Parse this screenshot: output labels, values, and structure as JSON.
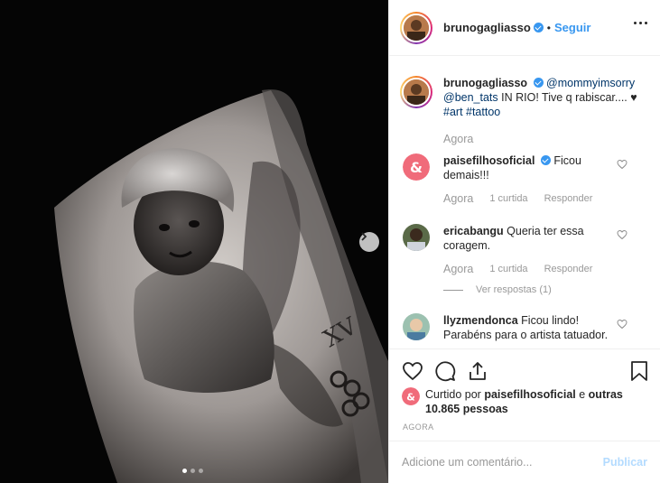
{
  "post": {
    "username": "brunogagliasso",
    "separator": "•",
    "follow_label": "Seguir",
    "caption_mentions": "@mommyimsorry @ben_tats",
    "caption_text": "IN RIO! Tive q rabiscar.... ♥",
    "caption_tags": "#art #tattoo",
    "caption_time": "Agora"
  },
  "comments": [
    {
      "username": "paisefilhosoficial",
      "verified": true,
      "text": "Ficou demais!!!",
      "time": "Agora",
      "likes": "1 curtida",
      "reply": "Responder"
    },
    {
      "username": "ericabangu",
      "verified": false,
      "text": "Queria ter essa coragem.",
      "time": "Agora",
      "likes": "1 curtida",
      "reply": "Responder",
      "view_replies": "Ver respostas (1)"
    },
    {
      "username": "llyzmendonca",
      "verified": false,
      "text": "Ficou lindo! Parabéns para o artista tatuador."
    }
  ],
  "likes": {
    "prefix": "Curtido por",
    "user": "paisefilhosoficial",
    "middle": "e",
    "others": "outras 10.865 pessoas"
  },
  "timestamp": "AGORA",
  "comment_input": {
    "placeholder": "Adicione um comentário...",
    "publish_label": "Publicar"
  },
  "carousel": {
    "slides": 3,
    "active": 1
  },
  "colors": {
    "accent": "#3897f0",
    "text": "#262626",
    "muted": "#999999",
    "publish_disabled": "#b3dbff",
    "paisefilhos_brand": "#f06b7a"
  },
  "icons": {
    "like": "heart-icon",
    "comment": "comment-icon",
    "share": "share-icon",
    "save": "bookmark-icon",
    "more": "more-options-icon",
    "next": "chevron-right-icon"
  }
}
